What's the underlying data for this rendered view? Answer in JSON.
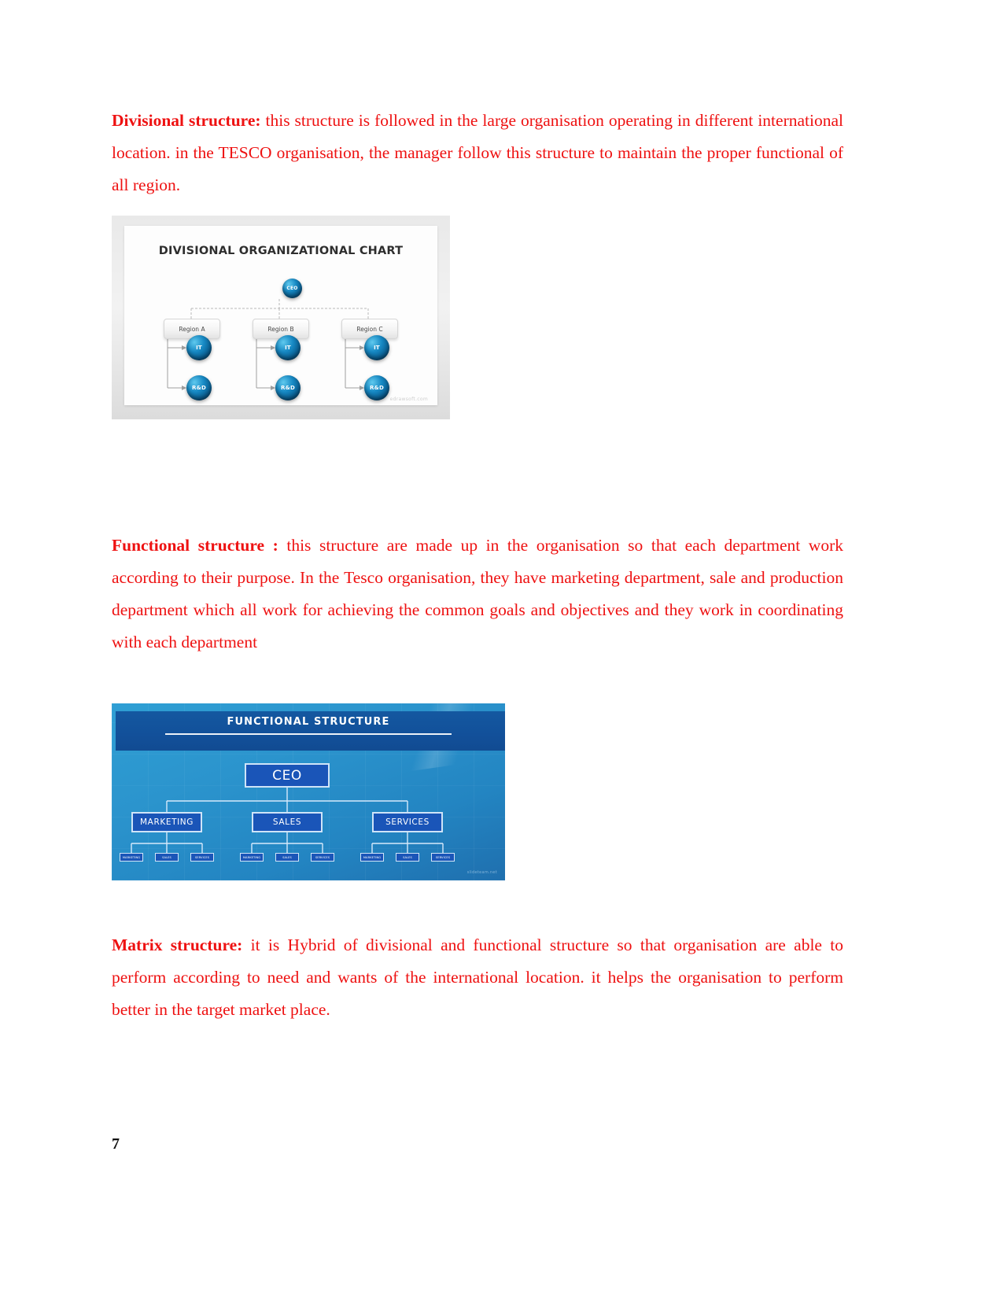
{
  "document": {
    "page_number": "7",
    "text_color": "#ee1111"
  },
  "sections": {
    "divisional": {
      "heading": "Divisional structure:",
      "body": "  this structure is followed in the large organisation operating in different international location. in the TESCO organisation, the manager follow this structure to maintain the proper functional of all region."
    },
    "functional": {
      "heading": "Functional structure :",
      "body": " this structure are made up in the organisation so that each department work according to their purpose. In the Tesco organisation,  they have marketing department, sale  and production department which all work for achieving the common goals and objectives and they work in coordinating with each department"
    },
    "matrix": {
      "heading": "Matrix structure:",
      "body": "  it is Hybrid of divisional and  functional structure so that organisation are able  to  perform  according  to  need  and   wants  of  the  international  location.  it  helps  the organisation to perform better in the target market place."
    }
  },
  "divisional_chart": {
    "title": "DIVISIONAL ORGANIZATIONAL CHART",
    "root": "CEO",
    "regions": [
      "Region A",
      "Region B",
      "Region C"
    ],
    "functions": [
      "IT",
      "R&D"
    ],
    "watermark": "edrawsoft.com",
    "colors": {
      "node_fill": "#1789c4",
      "card_bg": "#fdfdfd",
      "frame_bg": "#e9e9e9"
    }
  },
  "functional_chart": {
    "title": "FUNCTIONAL STRUCTURE",
    "root": "CEO",
    "level2": [
      "MARKETING",
      "SALES",
      "SERVICES"
    ],
    "level3": [
      [
        "MARKETING",
        "SALES",
        "SERVICES"
      ],
      [
        "MARKETING",
        "SALES",
        "SERVICES"
      ],
      [
        "MARKETING",
        "SALES",
        "SERVICES"
      ]
    ],
    "watermark": "slideteam.net",
    "colors": {
      "background": "#2b94cd",
      "header": "#12509a",
      "box_fill": "#1a55b8",
      "box_border": "#cfe4f8"
    }
  }
}
